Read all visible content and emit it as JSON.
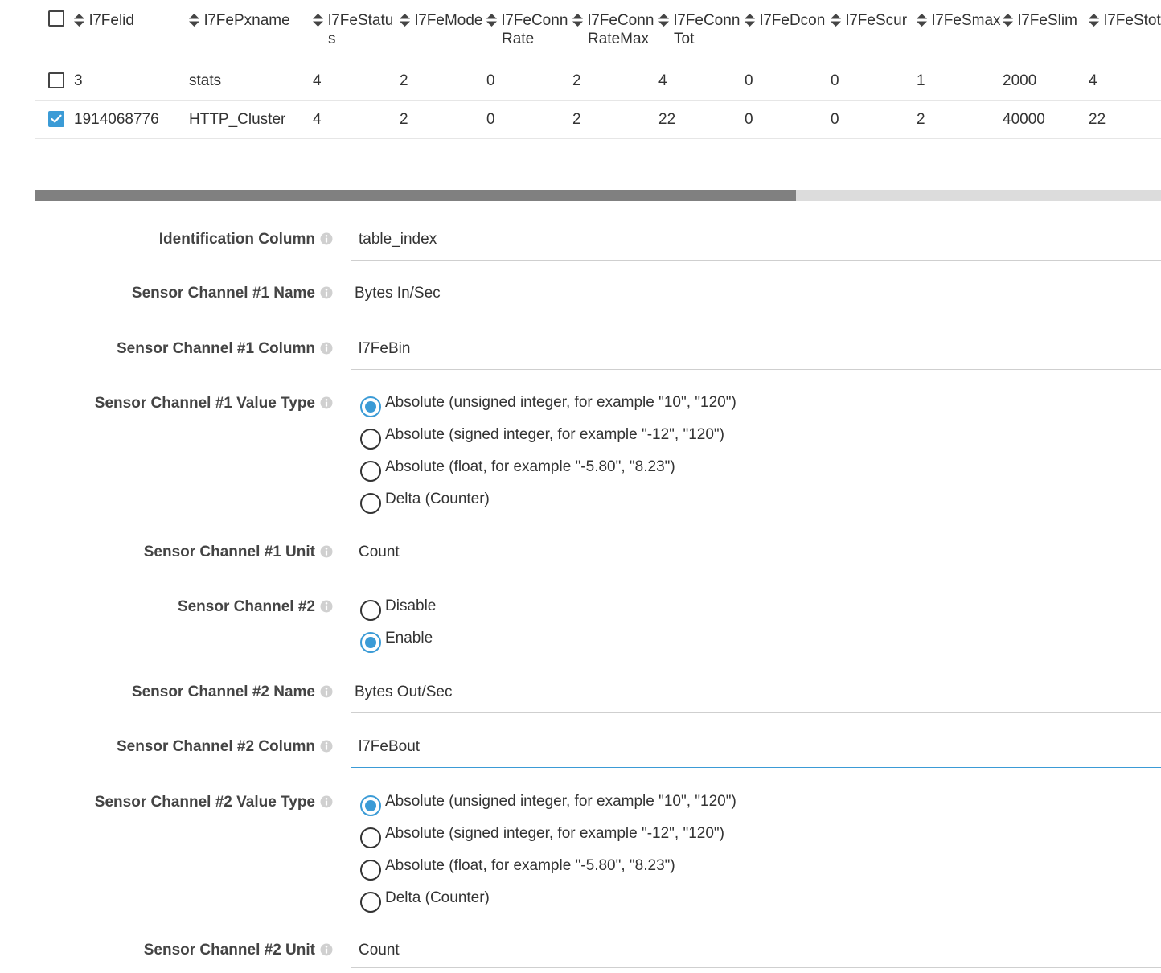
{
  "table": {
    "columns": [
      "l7Felid",
      "l7FePxname",
      "l7FeStatus",
      "l7FeMode",
      "l7FeConnRate",
      "l7FeConnRateMax",
      "l7FeConnTot",
      "l7FeDcon",
      "l7FeScur",
      "l7FeSmax",
      "l7FeSlim",
      "l7FeStot"
    ],
    "rows": [
      {
        "checked": false,
        "cells": [
          "3",
          "stats",
          "4",
          "2",
          "0",
          "2",
          "4",
          "0",
          "0",
          "1",
          "2000",
          "4"
        ]
      },
      {
        "checked": true,
        "cells": [
          "1914068776",
          "HTTP_Cluster",
          "4",
          "2",
          "0",
          "2",
          "22",
          "0",
          "0",
          "2",
          "40000",
          "22"
        ]
      }
    ]
  },
  "scrollbar": {
    "thumb_fraction": 0.676
  },
  "form": {
    "identification_column": {
      "label": "Identification Column",
      "value": "table_index"
    },
    "ch1_name": {
      "label": "Sensor Channel #1 Name",
      "value": "Bytes In/Sec"
    },
    "ch1_column": {
      "label": "Sensor Channel #1 Column",
      "value": "l7FeBin"
    },
    "ch1_value_type": {
      "label": "Sensor Channel #1 Value Type",
      "options": [
        "Absolute (unsigned integer, for example \"10\", \"120\")",
        "Absolute (signed integer, for example \"-12\", \"120\")",
        "Absolute (float, for example \"-5.80\", \"8.23\")",
        "Delta (Counter)"
      ],
      "selected": 0
    },
    "ch1_unit": {
      "label": "Sensor Channel #1 Unit",
      "value": "Count"
    },
    "ch2": {
      "label": "Sensor Channel #2",
      "options": [
        "Disable",
        "Enable"
      ],
      "selected": 1
    },
    "ch2_name": {
      "label": "Sensor Channel #2 Name",
      "value": "Bytes Out/Sec"
    },
    "ch2_column": {
      "label": "Sensor Channel #2 Column",
      "value": "l7FeBout"
    },
    "ch2_value_type": {
      "label": "Sensor Channel #2 Value Type",
      "options": [
        "Absolute (unsigned integer, for example \"10\", \"120\")",
        "Absolute (signed integer, for example \"-12\", \"120\")",
        "Absolute (float, for example \"-5.80\", \"8.23\")",
        "Delta (Counter)"
      ],
      "selected": 0
    },
    "ch2_unit": {
      "label": "Sensor Channel #2 Unit",
      "value": "Count"
    }
  },
  "colors": {
    "accent": "#3b9bd6",
    "scroll_thumb": "#808080",
    "scroll_track": "#dcdcdc"
  }
}
